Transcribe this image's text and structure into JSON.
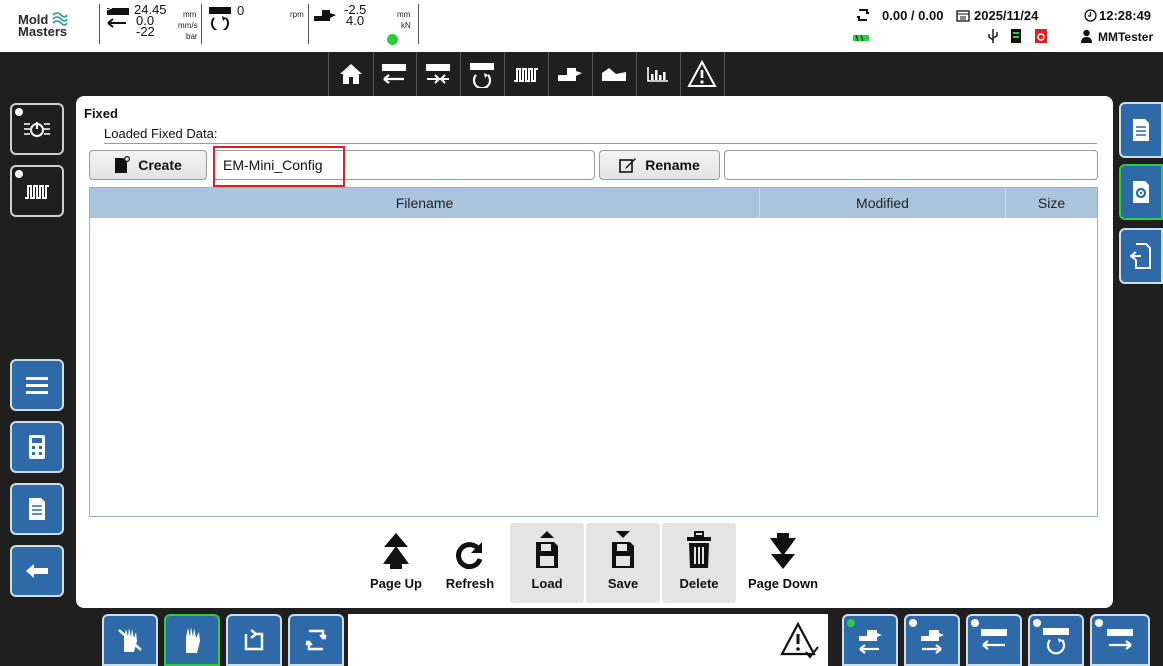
{
  "header": {
    "logo_line1": "Mold",
    "logo_line2": "Masters",
    "readings": {
      "position": "24.45",
      "position_unit": "mm",
      "speed": "0.0",
      "speed_unit": "mm/s",
      "pressure": "-22",
      "pressure_unit": "bar",
      "screw_rpm": "0",
      "rpm_unit": "rpm",
      "carriage_pos": "-2.5",
      "carriage_unit": "mm",
      "force": "4.0",
      "force_unit": "kN"
    },
    "cycle_times": "0.00 / 0.00",
    "date": "2025/11/24",
    "time": "12:28:49",
    "user": "MMTester"
  },
  "panel": {
    "title": "Fixed",
    "loaded_label": "Loaded Fixed Data:",
    "create_label": "Create",
    "filename_value": "EM-Mini_Config",
    "rename_label": "Rename",
    "rename_value": ""
  },
  "table": {
    "columns": [
      "Filename",
      "Modified",
      "Size"
    ],
    "rows": []
  },
  "actions": {
    "page_up": "Page Up",
    "refresh": "Refresh",
    "load": "Load",
    "save": "Save",
    "delete": "Delete",
    "page_down": "Page Down"
  },
  "colors": {
    "accent_blue": "#2f6aa8",
    "active_green": "#2ecc40",
    "table_header": "#a9c4dc",
    "highlight_red": "#e02020",
    "background": "#1f1f1f"
  }
}
